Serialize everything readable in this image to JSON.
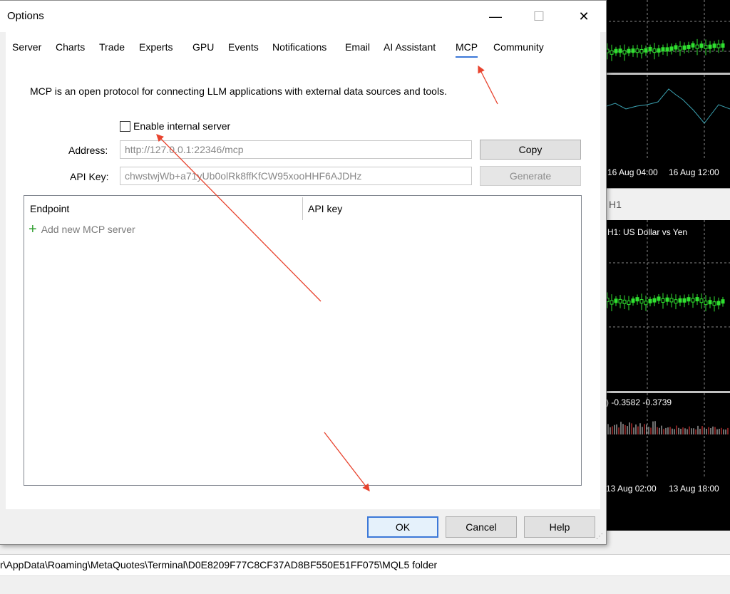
{
  "dialog": {
    "title": "Options",
    "min_glyph": "—",
    "max_glyph": "☐",
    "close_glyph": "✕",
    "tabs": [
      {
        "label": "Server"
      },
      {
        "label": "Charts"
      },
      {
        "label": "Trade"
      },
      {
        "label": "Experts"
      },
      {
        "label": "GPU"
      },
      {
        "label": "Events"
      },
      {
        "label": "Notifications"
      },
      {
        "label": "Email"
      },
      {
        "label": "AI Assistant"
      },
      {
        "label": "MCP",
        "active": true
      },
      {
        "label": "Community"
      }
    ],
    "description": "MCP is an open protocol for connecting LLM applications with external data sources and tools.",
    "enable_server": {
      "label": "Enable internal server",
      "checked": false
    },
    "address": {
      "label": "Address:",
      "value": "http://127.0.0.1:22346/mcp"
    },
    "api_key": {
      "label": "API Key:",
      "value": "chwstwjWb+a71yUb0olRk8ffKfCW95xooHHF6AJDHz"
    },
    "copy_label": "Copy",
    "generate_label": "Generate",
    "list": {
      "columns": [
        "Endpoint",
        "API key"
      ],
      "add_label": "Add new MCP server",
      "plus_glyph": "+"
    },
    "ok_label": "OK",
    "cancel_label": "Cancel",
    "help_label": "Help",
    "accent_color": "#3c78d8",
    "arrow_color": "#e8432e"
  },
  "background": {
    "folder_path": "r\\AppData\\Roaming\\MetaQuotes\\Terminal\\D0E8209F77C8CF37AD8BF550E51FF075\\MQL5 folder",
    "chart1_times": [
      "16 Aug 04:00",
      "16 Aug 12:00"
    ],
    "chart2_title": "H1",
    "chart2_caption": "H1: US Dollar vs Yen",
    "chart2_indicator": ") -0.3582 -0.3739",
    "chart2_times": [
      "13 Aug 02:00",
      "13 Aug 18:00"
    ]
  }
}
